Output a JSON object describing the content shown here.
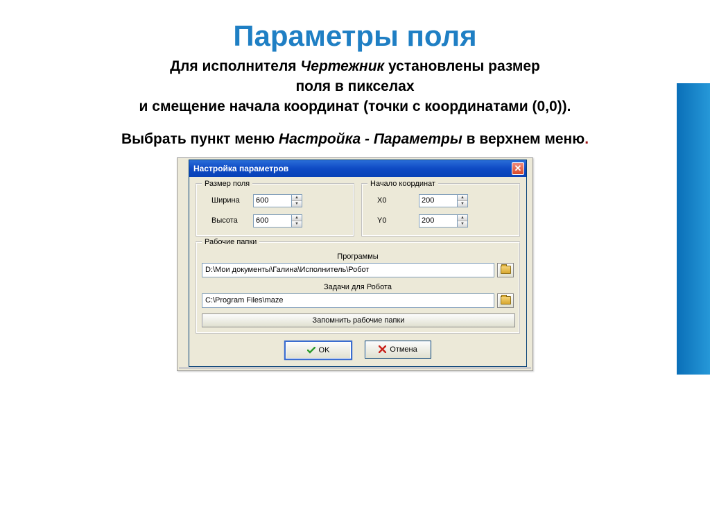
{
  "page": {
    "title": "Параметры поля",
    "subtitle_line1_a": "Для исполнителя ",
    "subtitle_line1_b": "Чертежник",
    "subtitle_line1_c": "  установлены размер",
    "subtitle_line2": "поля в пикселах",
    "subtitle_line3": "и смещение начала координат (точки с координатами (0,0)).",
    "instruction_a": "Выбрать пункт меню ",
    "instruction_b": "Настройка - Параметры",
    "instruction_c": " в верхнем меню",
    "instruction_period": "."
  },
  "dialog": {
    "title": "Настройка параметров",
    "field_size": {
      "group_label": "Размер поля",
      "width_label": "Ширина",
      "width_value": "600",
      "height_label": "Высота",
      "height_value": "600"
    },
    "origin": {
      "group_label": "Начало координат",
      "x_label": "X0",
      "x_value": "200",
      "y_label": "Y0",
      "y_value": "200"
    },
    "folders": {
      "group_label": "Рабочие папки",
      "programs_label": "Программы",
      "programs_path": "D:\\Мои документы\\Галина\\Исполнитель\\Робот",
      "tasks_label": "Задачи для Робота",
      "tasks_path": "C:\\Program Files\\maze",
      "remember_label": "Запомнить рабочие папки"
    },
    "buttons": {
      "ok": "OK",
      "cancel": "Отмена"
    }
  }
}
